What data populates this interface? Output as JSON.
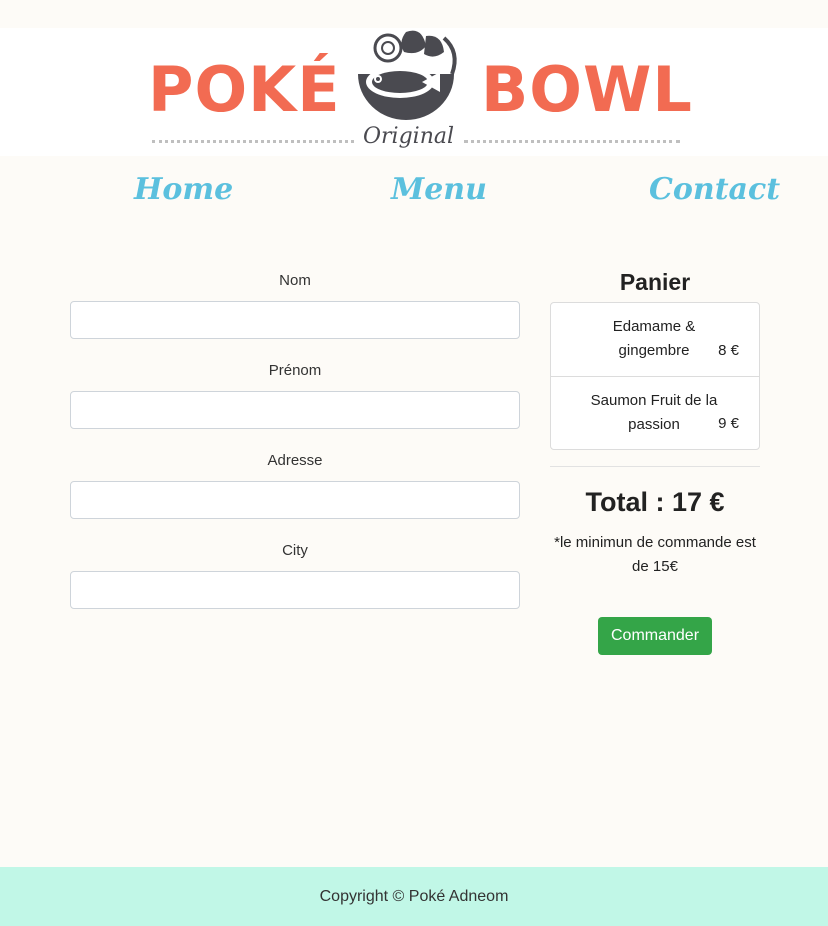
{
  "logo": {
    "left_word": "POKÉ",
    "right_word": "BOWL",
    "subtitle": "Original",
    "icon": "fish-bowl-icon",
    "color": "#f26b52"
  },
  "nav": {
    "items": [
      {
        "label": "Home"
      },
      {
        "label": "Menu"
      },
      {
        "label": "Contact"
      }
    ],
    "color": "#5bc0de"
  },
  "form": {
    "fields": [
      {
        "label": "Nom",
        "value": "",
        "placeholder": ""
      },
      {
        "label": "Prénom",
        "value": "",
        "placeholder": ""
      },
      {
        "label": "Adresse",
        "value": "",
        "placeholder": ""
      },
      {
        "label": "City",
        "value": "",
        "placeholder": ""
      }
    ]
  },
  "cart": {
    "title": "Panier",
    "items": [
      {
        "name": "Edamame & gingembre",
        "price": "8 €"
      },
      {
        "name": "Saumon Fruit de la passion",
        "price": "9 €"
      }
    ],
    "total": "Total : 17 €",
    "note": "*le minimun de commande est de 15€",
    "button": "Commander",
    "button_color": "#34a548"
  },
  "footer": {
    "text": "Copyright © Poké Adneom",
    "color": "#c1f7e7"
  }
}
